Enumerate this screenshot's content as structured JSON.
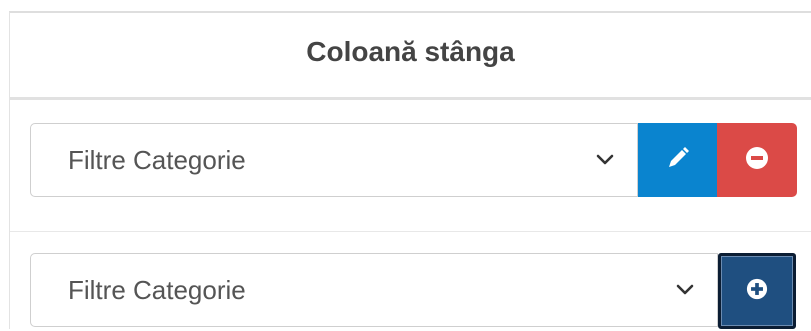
{
  "panel": {
    "title": "Coloană stânga"
  },
  "rows": [
    {
      "select": {
        "value": "Filtre Categorie",
        "icon": "chevron-down-icon"
      },
      "buttons": [
        {
          "icon": "pencil-icon",
          "color": "#0a84cf"
        },
        {
          "icon": "minus-circle-icon",
          "color": "#db4a47"
        }
      ]
    },
    {
      "select": {
        "value": "Filtre Categorie",
        "icon": "chevron-down-icon"
      },
      "buttons": [
        {
          "icon": "plus-circle-icon",
          "color": "#1f4f80"
        }
      ]
    }
  ]
}
